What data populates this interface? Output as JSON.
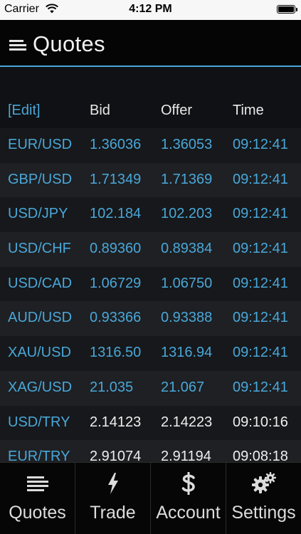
{
  "status_bar": {
    "carrier": "Carrier",
    "time": "4:12 PM"
  },
  "header": {
    "title": "Quotes"
  },
  "table": {
    "edit_label": "[Edit]",
    "columns": [
      "Bid",
      "Offer",
      "Time"
    ],
    "rows": [
      {
        "symbol": "EUR/USD",
        "bid": "1.36036",
        "offer": "1.36053",
        "time": "09:12:41"
      },
      {
        "symbol": "GBP/USD",
        "bid": "1.71349",
        "offer": "1.71369",
        "time": "09:12:41"
      },
      {
        "symbol": "USD/JPY",
        "bid": "102.184",
        "offer": "102.203",
        "time": "09:12:41"
      },
      {
        "symbol": "USD/CHF",
        "bid": "0.89360",
        "offer": "0.89384",
        "time": "09:12:41"
      },
      {
        "symbol": "USD/CAD",
        "bid": "1.06729",
        "offer": "1.06750",
        "time": "09:12:41"
      },
      {
        "symbol": "AUD/USD",
        "bid": "0.93366",
        "offer": "0.93388",
        "time": "09:12:41"
      },
      {
        "symbol": "XAU/USD",
        "bid": "1316.50",
        "offer": "1316.94",
        "time": "09:12:41"
      },
      {
        "symbol": "XAG/USD",
        "bid": "21.035",
        "offer": "21.067",
        "time": "09:12:41"
      },
      {
        "symbol": "USD/TRY",
        "bid": "2.14123",
        "offer": "2.14223",
        "time": "09:10:16"
      },
      {
        "symbol": "EUR/TRY",
        "bid": "2.91074",
        "offer": "2.91194",
        "time": "09:08:18"
      }
    ]
  },
  "tab_bar": {
    "tabs": [
      {
        "label": "Quotes",
        "icon": "quotes-lines-icon"
      },
      {
        "label": "Trade",
        "icon": "lightning-icon"
      },
      {
        "label": "Account",
        "icon": "dollar-icon"
      },
      {
        "label": "Settings",
        "icon": "gears-icon"
      }
    ]
  },
  "colors": {
    "accent": "#4aa7d8",
    "background": "#0d0e10",
    "row_odd": "#16181b",
    "row_even": "#1e2024",
    "header_text": "#e9e9e9"
  }
}
